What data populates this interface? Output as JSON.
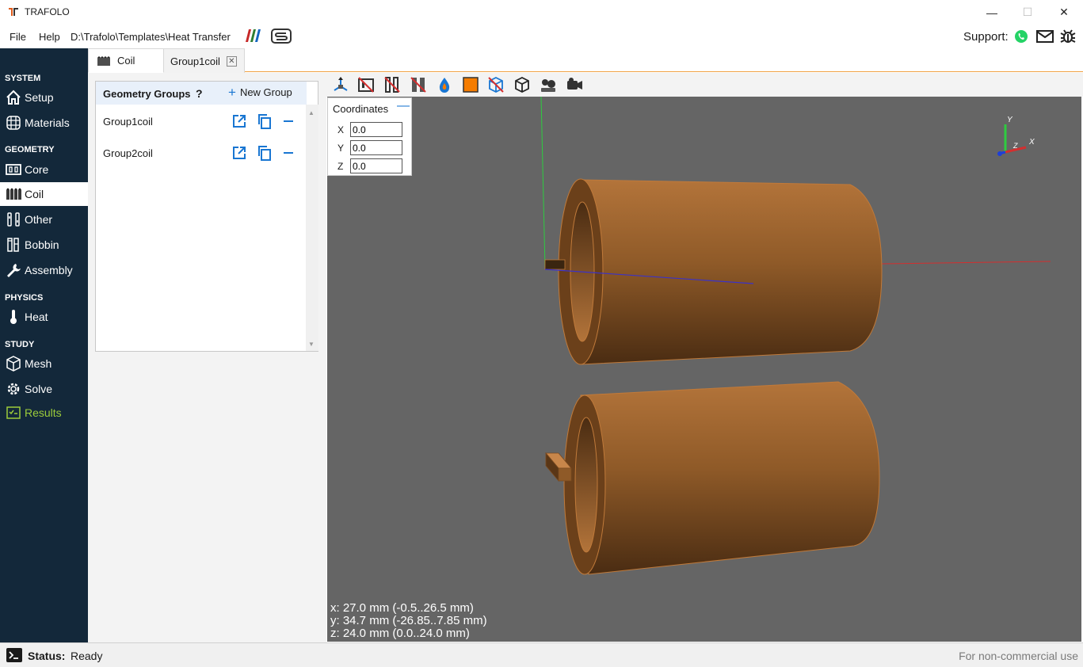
{
  "app": {
    "title": "TRAFOLO"
  },
  "window_controls": {
    "minimize": "—",
    "maximize": "☐",
    "close": "✕"
  },
  "menu": {
    "file": "File",
    "help": "Help",
    "path": "D:\\Trafolo\\Templates\\Heat Transfer"
  },
  "support": {
    "label": "Support:"
  },
  "tabs": [
    {
      "label": "Coil"
    },
    {
      "label": "Group1coil"
    }
  ],
  "sidebar": {
    "sections": {
      "system": "SYSTEM",
      "geometry": "GEOMETRY",
      "physics": "PHYSICS",
      "study": "STUDY"
    },
    "items": [
      {
        "label": "Setup",
        "icon": "home-icon"
      },
      {
        "label": "Materials",
        "icon": "grid-globe-icon"
      },
      {
        "label": "Core",
        "icon": "core-icon"
      },
      {
        "label": "Coil",
        "icon": "coil-icon"
      },
      {
        "label": "Other",
        "icon": "other-icon"
      },
      {
        "label": "Bobbin",
        "icon": "bobbin-icon"
      },
      {
        "label": "Assembly",
        "icon": "wrench-icon"
      },
      {
        "label": "Heat",
        "icon": "thermometer-icon"
      },
      {
        "label": "Mesh",
        "icon": "mesh-cube-icon"
      },
      {
        "label": "Solve",
        "icon": "solve-gear-icon"
      },
      {
        "label": "Results",
        "icon": "results-check-icon"
      }
    ]
  },
  "geometry_groups": {
    "title": "Geometry Groups",
    "help": "?",
    "new_group": "New Group",
    "groups": [
      {
        "name": "Group1coil"
      },
      {
        "name": "Group2coil"
      }
    ]
  },
  "coordinates": {
    "title": "Coordinates",
    "collapse": "—",
    "x_label": "X",
    "x_value": "0.0",
    "y_label": "Y",
    "y_value": "0.0",
    "z_label": "Z",
    "z_value": "0.0"
  },
  "dimensions": {
    "x": "x: 27.0 mm (-0.5..26.5 mm)",
    "y": "y: 34.7 mm (-26.85..7.85 mm)",
    "z": "z: 24.0 mm (0.0..24.0 mm)"
  },
  "axes_triad": {
    "x": "X",
    "y": "Y",
    "z": "Z"
  },
  "status": {
    "label": "Status:",
    "value": "Ready",
    "license": "For non-commercial use"
  },
  "colors": {
    "sidebar_bg": "#13283a",
    "accent": "#1976d2",
    "coil_copper": "#8b5a2b",
    "viewport_bg": "#656565",
    "results_green": "#9ccc3a"
  }
}
